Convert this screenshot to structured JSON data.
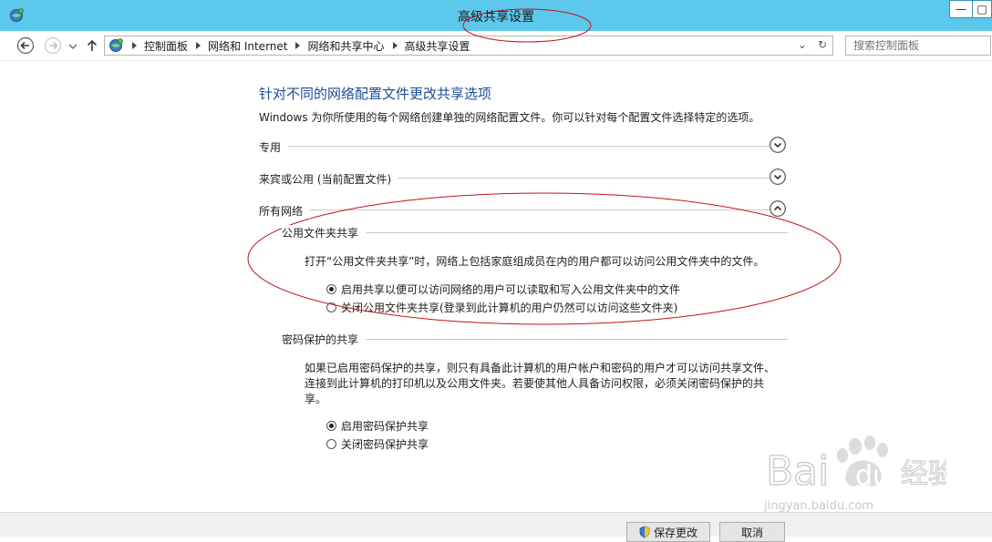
{
  "window": {
    "title": "高级共享设置",
    "minimize_glyph": "—",
    "maximize_glyph": "□"
  },
  "address_bar": {
    "breadcrumbs": [
      "控制面板",
      "网络和 Internet",
      "网络和共享中心",
      "高级共享设置"
    ],
    "dropdown_glyph": "⌄",
    "refresh_glyph": "↻"
  },
  "search": {
    "placeholder": "搜索控制面板"
  },
  "main": {
    "heading": "针对不同的网络配置文件更改共享选项",
    "description": "Windows 为你所使用的每个网络创建单独的网络配置文件。你可以针对每个配置文件选择特定的选项。",
    "sections": [
      {
        "label": "专用",
        "expanded": false
      },
      {
        "label": "来宾或公用 (当前配置文件)",
        "expanded": false
      },
      {
        "label": "所有网络",
        "expanded": true
      }
    ],
    "public_folder": {
      "title": "公用文件夹共享",
      "description": "打开“公用文件夹共享”时，网络上包括家庭组成员在内的用户都可以访问公用文件夹中的文件。",
      "options": [
        {
          "label": "启用共享以便可以访问网络的用户可以读取和写入公用文件夹中的文件",
          "checked": true
        },
        {
          "label": "关闭公用文件夹共享(登录到此计算机的用户仍然可以访问这些文件夹)",
          "checked": false
        }
      ]
    },
    "password": {
      "title": "密码保护的共享",
      "description_lines": [
        "如果已启用密码保护的共享，则只有具备此计算机的用户帐户和密码的用户才可以访问共享文件、",
        "连接到此计算机的打印机以及公用文件夹。若要使其他人具备访问权限，必须关闭密码保护的共",
        "享。"
      ],
      "options": [
        {
          "label": "启用密码保护共享",
          "checked": true
        },
        {
          "label": "关闭密码保护共享",
          "checked": false
        }
      ]
    }
  },
  "footer": {
    "save_label": "保存更改",
    "cancel_label": "取消"
  },
  "watermark": {
    "logo_text": "Bai du 经验",
    "url": "jingyan.baidu.com"
  },
  "colors": {
    "titlebar": "#5cc8ec",
    "heading": "#1e4d96",
    "annotation": "#c0141b"
  }
}
